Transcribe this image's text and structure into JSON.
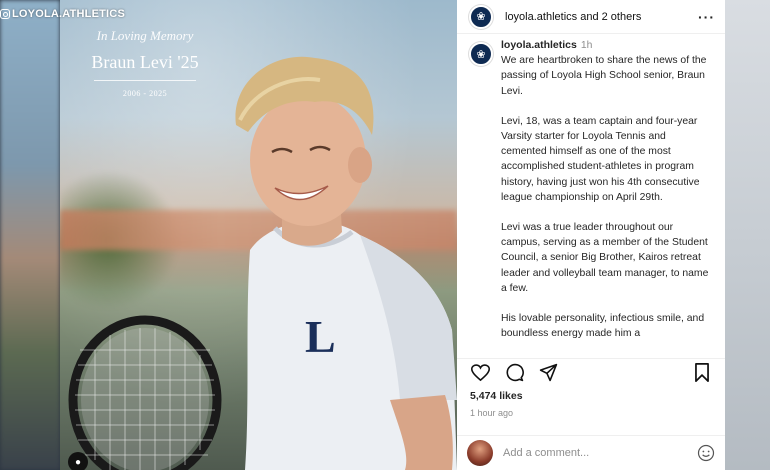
{
  "watermark": {
    "handle": "LOYOLA.ATHLETICS",
    "icon": "instagram-icon"
  },
  "photo": {
    "memorial_line1": "In Loving Memory",
    "memorial_name": "Braun Levi '25",
    "memorial_years": "2006 - 2025",
    "shirt_letter": "L"
  },
  "post": {
    "header": {
      "username": "loyola.athletics",
      "collab_text": "and 2 others",
      "avatar_icon": "paw-logo-icon"
    },
    "caption": {
      "username": "loyola.athletics",
      "time": "1h",
      "paragraphs": [
        "We are heartbroken to share the news of the passing of Loyola High School senior, Braun Levi.",
        "Levi, 18, was a team captain and four-year Varsity starter for Loyola Tennis and cemented himself as one of the most accomplished student-athletes in program history, having just won his 4th consecutive league championship on April 29th.",
        "Levi was a true leader throughout our campus, serving as a member of the Student Council, a senior Big Brother, Kairos retreat leader and volleyball team manager, to name a few.",
        "His lovable personality, infectious smile, and boundless energy made him a"
      ]
    },
    "likes": "5,474 likes",
    "time_ago": "1 hour ago",
    "comment_placeholder": "Add a comment...",
    "icons": [
      "heart-icon",
      "comment-icon",
      "share-icon",
      "bookmark-icon",
      "emoji-icon"
    ]
  },
  "colors": {
    "navy": "#0e2a52",
    "muted": "#8e8e8e",
    "text": "#262626"
  }
}
